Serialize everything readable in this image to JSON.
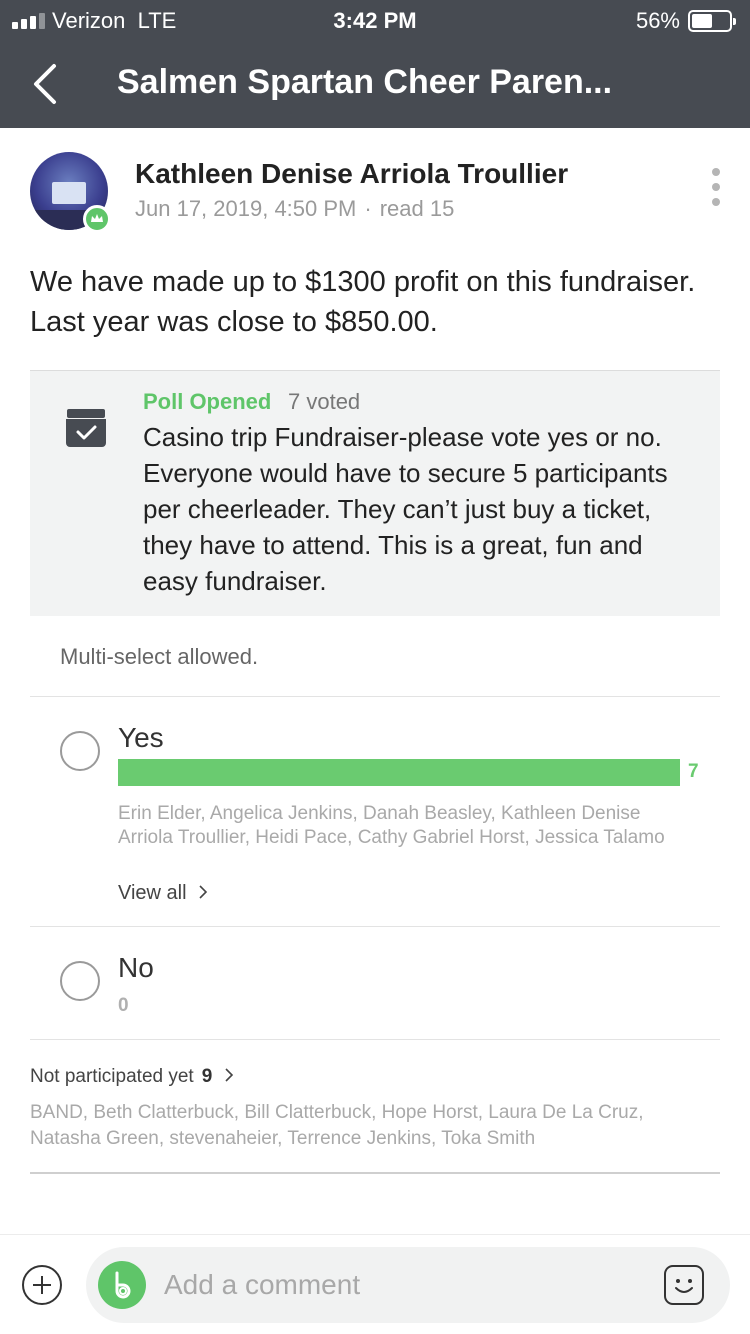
{
  "status_bar": {
    "carrier": "Verizon  LTE",
    "time": "3:42 PM",
    "battery": "56%",
    "battery_level": 0.56
  },
  "nav": {
    "title": "Salmen Spartan Cheer Paren..."
  },
  "post": {
    "author": "Kathleen Denise Arriola Troullier",
    "date": "Jun 17, 2019, 4:50 PM",
    "read": "read 15",
    "body": "We have made up to $1300 profit on this fundraiser. Last year was close to $850.00."
  },
  "poll": {
    "status": "Poll Opened",
    "voted": "7 voted",
    "question": "Casino trip Fundraiser-please vote yes or no. Everyone would have to secure 5 participants per cheerleader. They can’t just buy a ticket, they have to attend. This is a great, fun and easy fundraiser.",
    "multi_select": "Multi-select allowed.",
    "options": [
      {
        "label": "Yes",
        "count": "7",
        "fill_fraction": 1.0,
        "voters": "Erin Elder, Angelica Jenkins, Danah Beasley, Kathleen Denise Arriola Troullier, Heidi Pace, Cathy Gabriel Horst, Jessica Talamo",
        "view_all": "View all"
      },
      {
        "label": "No",
        "count": "0"
      }
    ],
    "not_participated": {
      "label": "Not participated yet",
      "count": "9",
      "names": "BAND, Beth Clatterbuck, Bill Clatterbuck, Hope Horst, Laura De La Cruz, Natasha Green, stevenaheier, Terrence Jenkins, Toka Smith"
    }
  },
  "comment_bar": {
    "placeholder": "Add a comment"
  },
  "colors": {
    "nav_bg": "#474b52",
    "accent_green": "#5fc569",
    "bar_green": "#6acb70"
  },
  "icons": {
    "back": "chevron-left-icon",
    "more": "vertical-dots-icon",
    "crown": "crown-icon",
    "poll": "ballot-box-check-icon",
    "add": "plus-circle-icon",
    "band": "band-logo-icon",
    "emoji": "smiley-icon"
  }
}
